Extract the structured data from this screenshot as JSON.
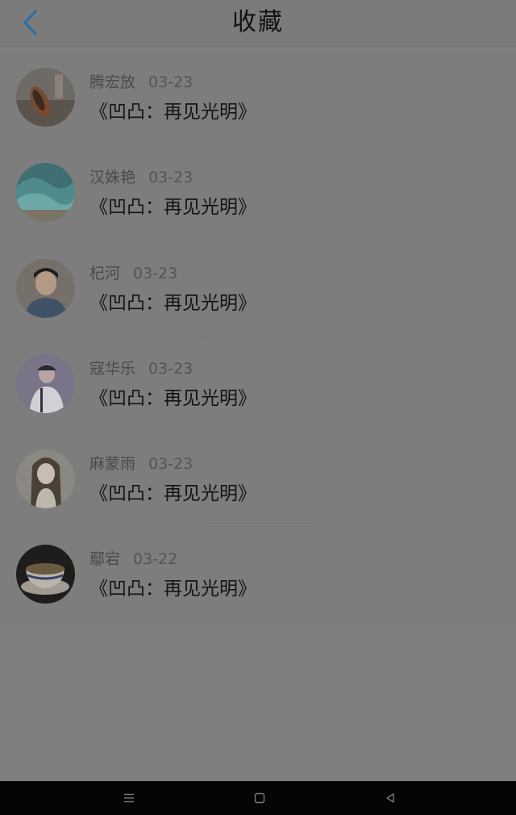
{
  "header": {
    "title": "收藏",
    "back_icon": "chevron-left-icon",
    "accent_color": "#2a6fa8"
  },
  "favorites": [
    {
      "user": "腾宏放",
      "date": "03-23",
      "title": "《凹凸：再见光明》",
      "avatar": "avatar-sneakers-photo"
    },
    {
      "user": "汉姝艳",
      "date": "03-23",
      "title": "《凹凸：再见光明》",
      "avatar": "avatar-wave-photo"
    },
    {
      "user": "杞河",
      "date": "03-23",
      "title": "《凹凸：再见光明》",
      "avatar": "avatar-boy-photo"
    },
    {
      "user": "寇华乐",
      "date": "03-23",
      "title": "《凹凸：再见光明》",
      "avatar": "avatar-singer-photo"
    },
    {
      "user": "麻蒙雨",
      "date": "03-23",
      "title": "《凹凸：再见光明》",
      "avatar": "avatar-anime-girl"
    },
    {
      "user": "鄢宕",
      "date": "03-22",
      "title": "《凹凸：再见光明》",
      "avatar": "avatar-teacup-photo"
    }
  ],
  "system_nav": {
    "menu_icon": "menu-icon",
    "home_icon": "square-home-icon",
    "back_icon": "triangle-back-icon"
  }
}
